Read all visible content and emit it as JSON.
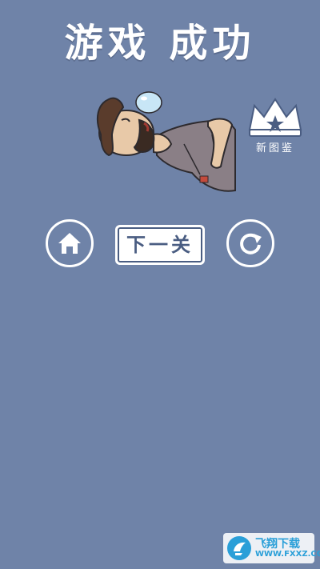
{
  "title": "游戏 成功",
  "collection": {
    "label": "新图鉴",
    "icon": "crown-star-icon"
  },
  "buttons": {
    "home_icon": "home-icon",
    "next_label": "下一关",
    "restart_icon": "restart-icon"
  },
  "watermark": {
    "brand": "飞翔下载",
    "domain": "WWW.FXXZ.COM"
  },
  "colors": {
    "background": "#6f83a8",
    "text": "#ffffff",
    "button_text": "#4a5d82"
  }
}
